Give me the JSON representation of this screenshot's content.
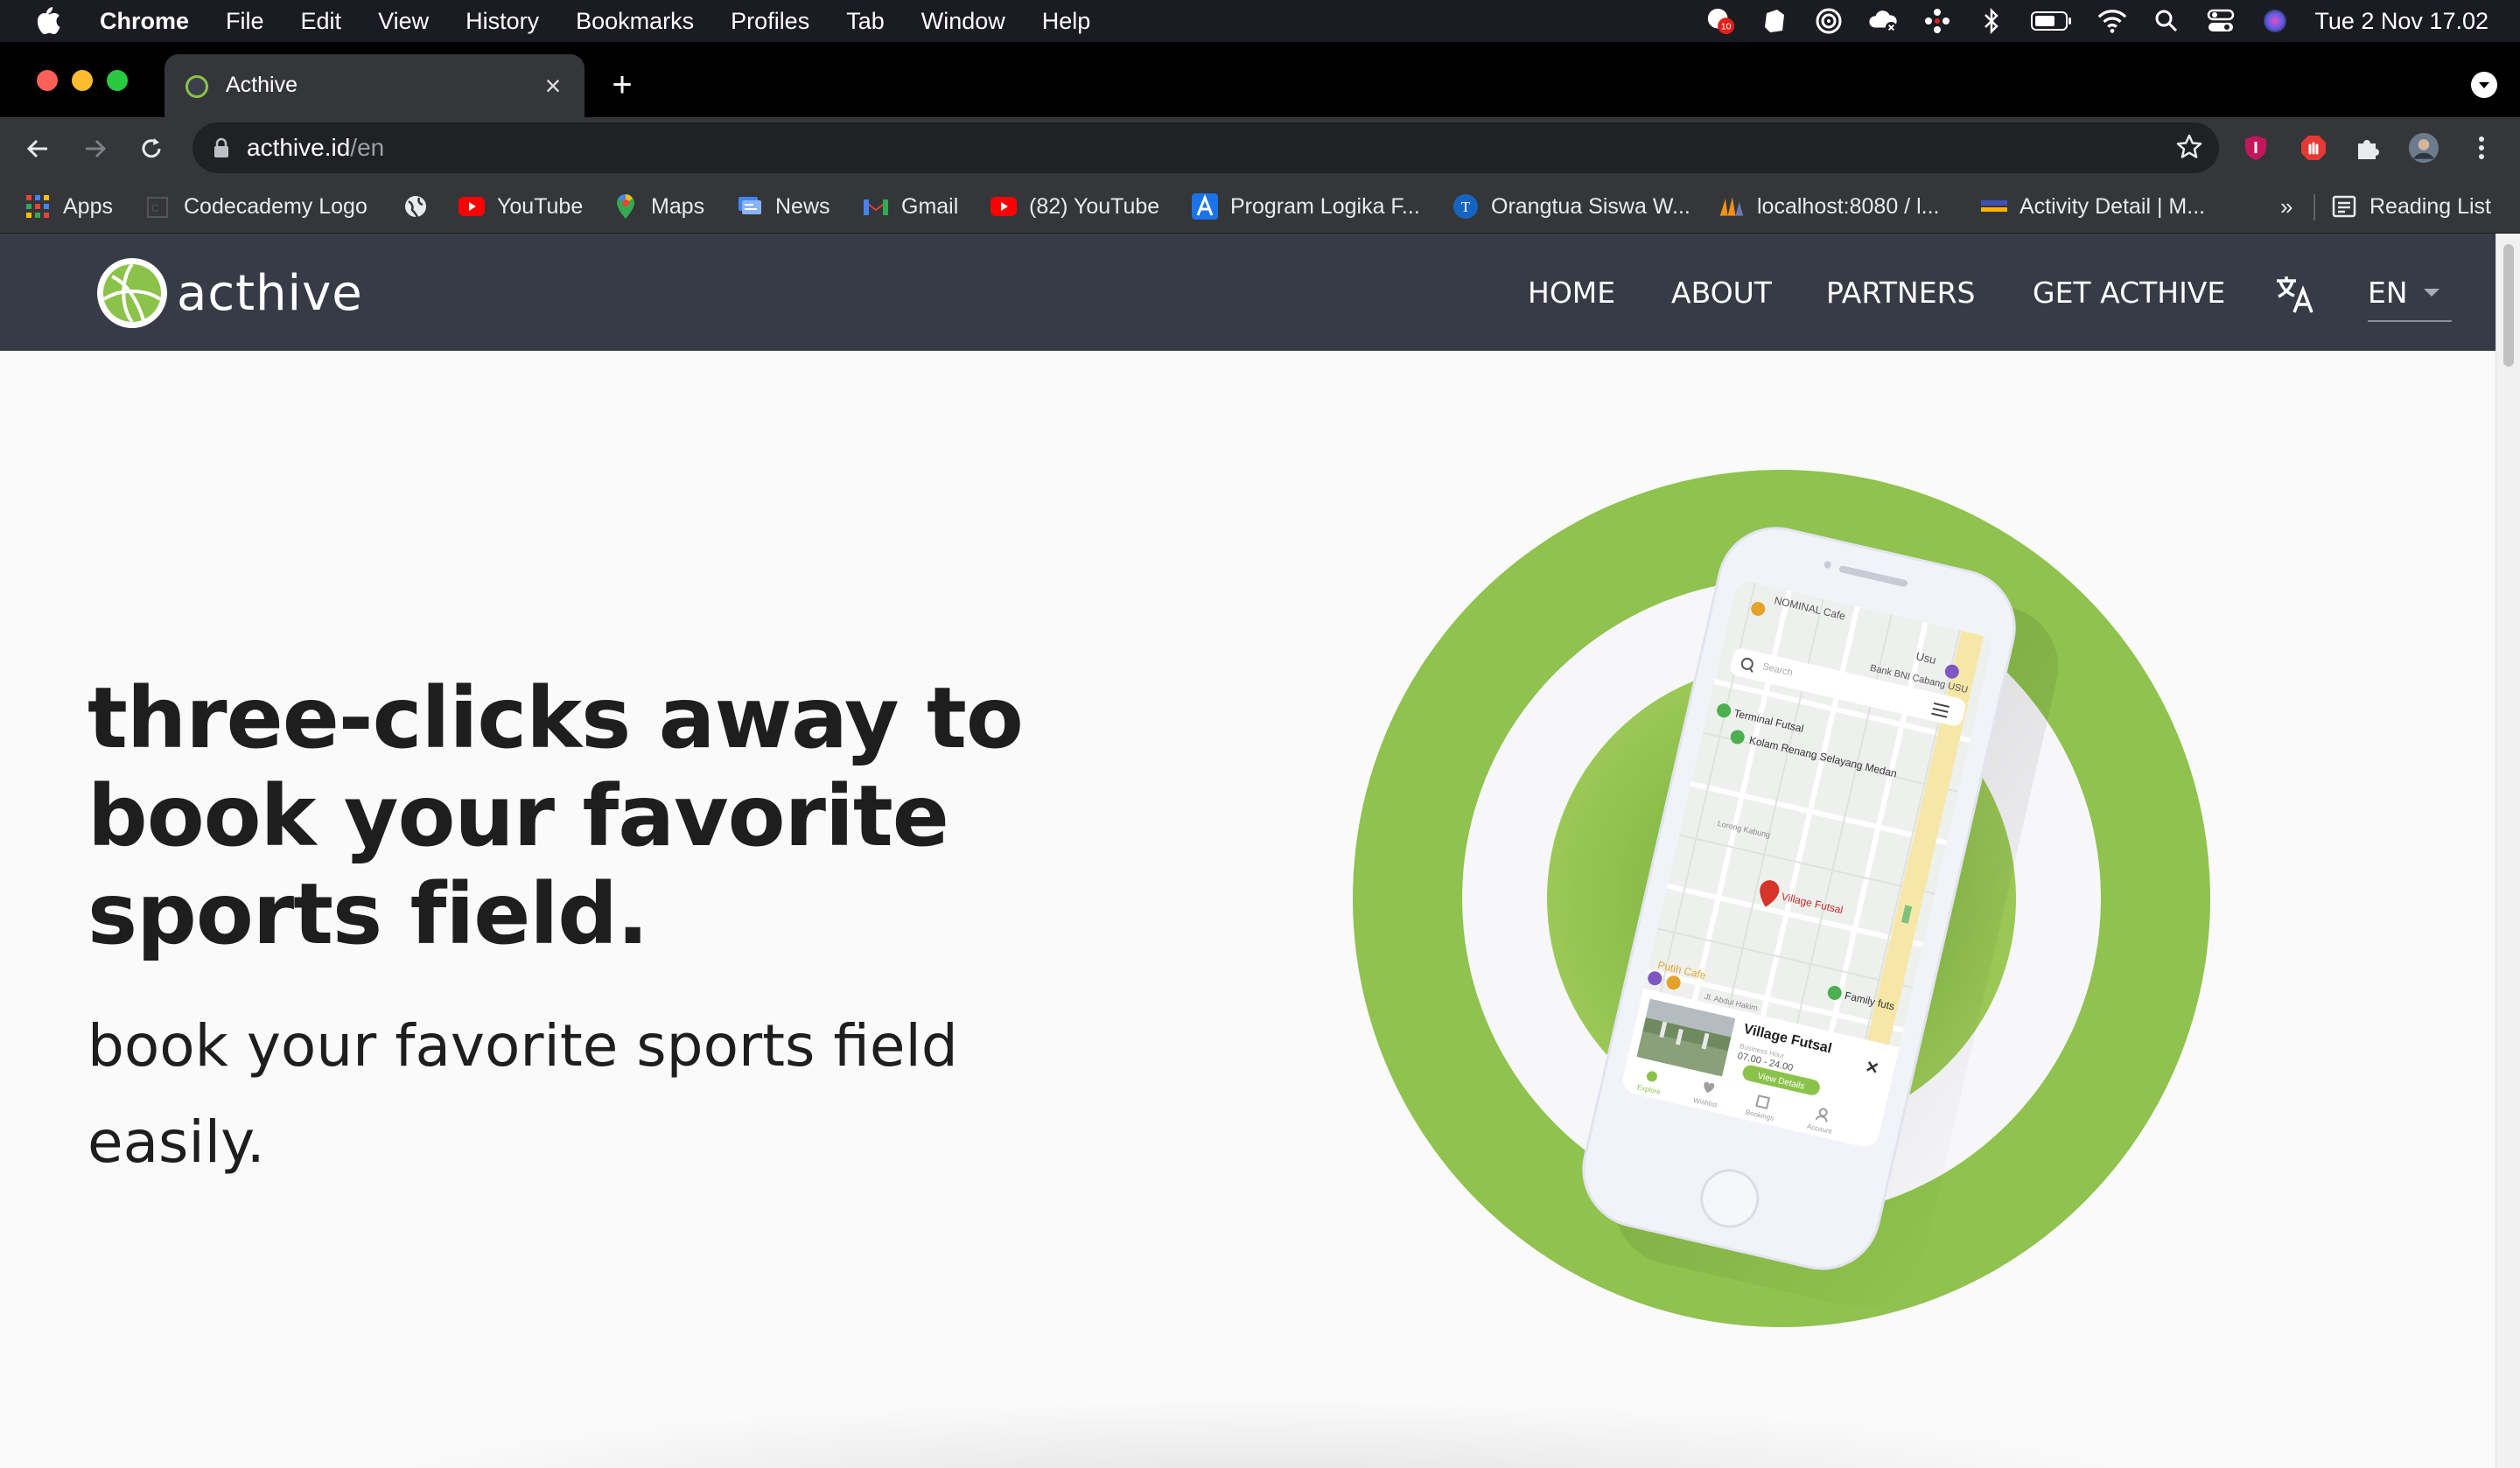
{
  "menubar": {
    "app_name": "Chrome",
    "items": [
      "File",
      "Edit",
      "View",
      "History",
      "Bookmarks",
      "Profiles",
      "Tab",
      "Window",
      "Help"
    ],
    "badge_count": "10",
    "clock": "Tue 2 Nov  17.02"
  },
  "browser": {
    "tab_title": "Acthive",
    "url_host": "acthive.id",
    "url_path": "/en"
  },
  "bookmarks": {
    "items": [
      "Apps",
      "Codecademy Logo",
      "YouTube",
      "Maps",
      "News",
      "Gmail",
      "(82) YouTube",
      "Program Logika F...",
      "Orangtua Siswa W...",
      "localhost:8080 / l...",
      "Activity Detail | M..."
    ],
    "overflow": "»",
    "reading_list": "Reading List"
  },
  "site": {
    "logo_text": "acthive",
    "nav": [
      "HOME",
      "ABOUT",
      "PARTNERS",
      "GET ACTHIVE"
    ],
    "language": "EN",
    "accent_color": "#8bc34a",
    "nav_bg": "#363b46"
  },
  "hero": {
    "title": "three-clicks away to book your favorite sports field.",
    "subtitle": "book your favorite sports field easily."
  },
  "phone": {
    "search_placeholder": "Search",
    "map_labels": [
      "NOMINAL Cafe",
      "Usu",
      "Bank BNI Cabang USU",
      "Terminal Futsal",
      "Kolam Renang Selayang Medan",
      "Lorong Kabung",
      "Village Futsal",
      "Putih Cafe",
      "Family futs",
      "Jl. Abdul Hakim"
    ],
    "card_title": "Village Futsal",
    "card_hours_label": "Business Hour",
    "card_hours": "07.00 - 24.00",
    "card_button": "View Details",
    "bottom_nav": [
      "Explore",
      "Wishlist",
      "Bookings",
      "Account"
    ]
  }
}
